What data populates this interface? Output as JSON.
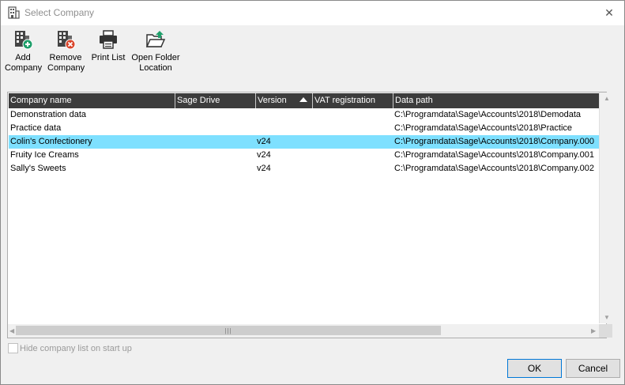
{
  "window": {
    "title": "Select Company",
    "close_glyph": "✕"
  },
  "toolbar": {
    "add_company": "Add\nCompany",
    "remove_company": "Remove\nCompany",
    "print_list": "Print List",
    "open_folder": "Open Folder\nLocation"
  },
  "table": {
    "columns": {
      "company_name": "Company name",
      "sage_drive": "Sage Drive",
      "version": "Version",
      "vat": "VAT registration",
      "data_path": "Data path"
    },
    "rows": [
      {
        "name": "Demonstration data",
        "drive": "",
        "version": "",
        "vat": "",
        "path": "C:\\Programdata\\Sage\\Accounts\\2018\\Demodata"
      },
      {
        "name": "Practice data",
        "drive": "",
        "version": "",
        "vat": "",
        "path": "C:\\Programdata\\Sage\\Accounts\\2018\\Practice"
      },
      {
        "name": "Colin's Confectionery",
        "drive": "",
        "version": "v24",
        "vat": "",
        "path": "C:\\Programdata\\Sage\\Accounts\\2018\\Company.000"
      },
      {
        "name": "Fruity Ice Creams",
        "drive": "",
        "version": "v24",
        "vat": "",
        "path": "C:\\Programdata\\Sage\\Accounts\\2018\\Company.001"
      },
      {
        "name": "Sally's Sweets",
        "drive": "",
        "version": "v24",
        "vat": "",
        "path": "C:\\Programdata\\Sage\\Accounts\\2018\\Company.002"
      }
    ],
    "selected_row": 2
  },
  "options": {
    "hide_list_label": "Hide company list on start up",
    "hide_list_checked": false
  },
  "buttons": {
    "ok": "OK",
    "cancel": "Cancel"
  },
  "icons": {
    "title": "building-icon",
    "add": "building-add-icon",
    "remove": "building-remove-icon",
    "print": "printer-icon",
    "folder": "folder-open-icon"
  },
  "colors": {
    "header_bg": "#3c3c3c",
    "selection": "#7ee0ff",
    "add_green": "#1e9e6a",
    "remove_red": "#d9452b"
  }
}
